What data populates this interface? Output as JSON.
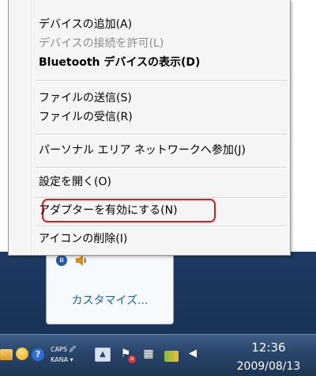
{
  "menu": {
    "items": [
      {
        "label": "デバイスの追加(A)",
        "enabled": true
      },
      {
        "label": "デバイスの接続を許可(L)",
        "enabled": false
      },
      {
        "label": "Bluetooth デバイスの表示(D)",
        "enabled": true,
        "bold": true
      },
      {
        "label": "ファイルの送信(S)",
        "enabled": true
      },
      {
        "label": "ファイルの受信(R)",
        "enabled": true
      },
      {
        "label": "パーソナル エリア ネットワークへ参加(J)",
        "enabled": true
      },
      {
        "label": "設定を開く(O)",
        "enabled": true
      },
      {
        "label": "アダプターを有効にする(N)",
        "enabled": true,
        "highlighted": true
      },
      {
        "label": "アイコンの削除(I)",
        "enabled": true
      }
    ]
  },
  "flyout": {
    "customize_label": "カスタマイズ..."
  },
  "taskbar": {
    "ime_caps": "CAPS",
    "ime_kana": "KANA",
    "ime_symbol": "🖉"
  },
  "clock": {
    "time": "12:36",
    "date": "2009/08/13"
  },
  "colors": {
    "highlight_outline": "#d32020",
    "link_blue": "#1f5faa",
    "taskbar": "#2a466c"
  }
}
